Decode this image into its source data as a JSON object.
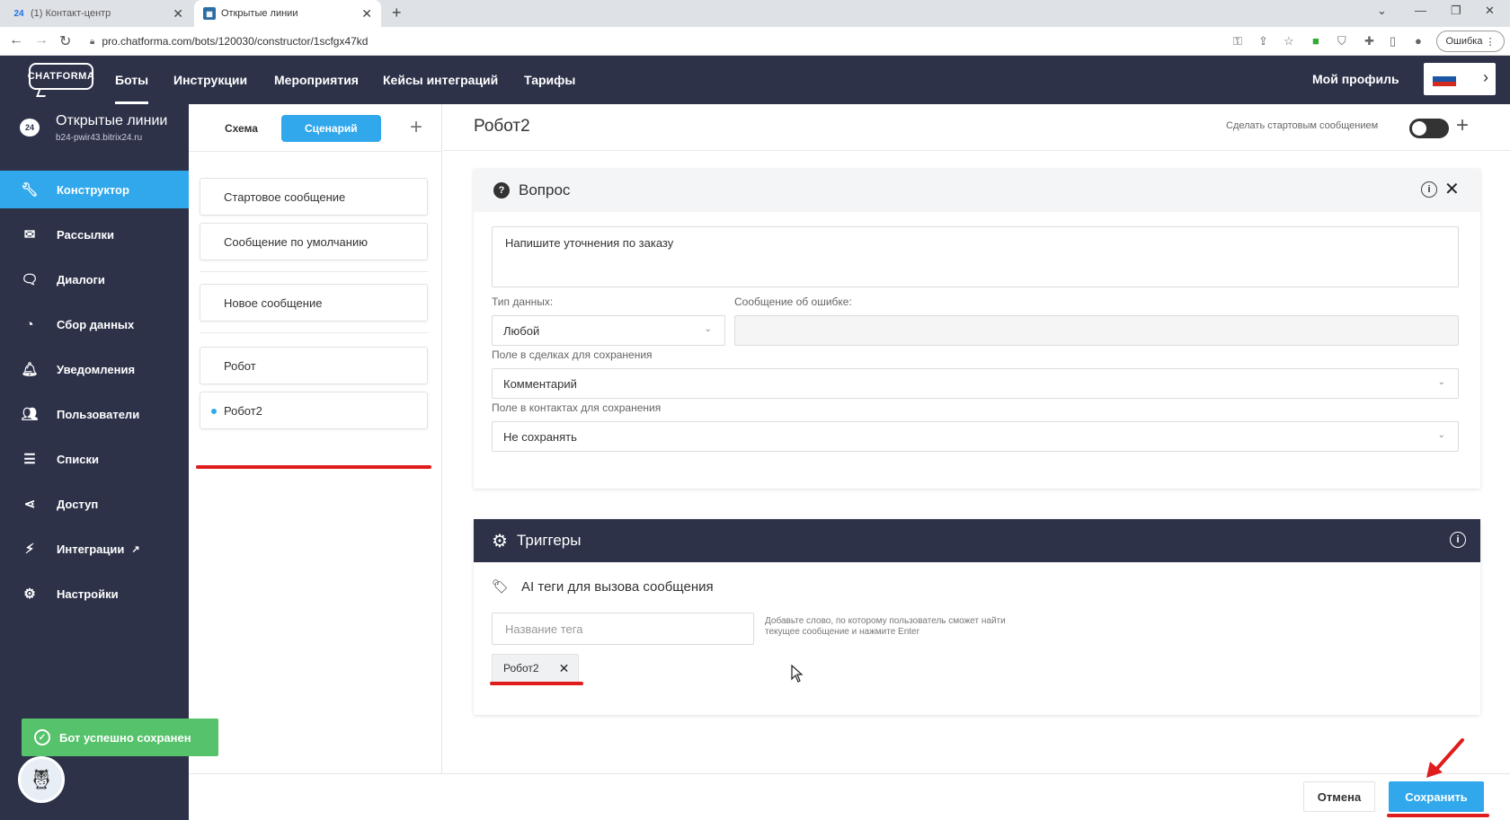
{
  "browser": {
    "tabs": [
      {
        "icon": "24",
        "title": "(1) Контакт-центр"
      },
      {
        "icon": "",
        "title": "Открытые линии"
      }
    ],
    "url": "pro.chatforma.com/bots/120030/constructor/1scfgx47kd",
    "profile_button": "Ошибка"
  },
  "header": {
    "logo": "CHATFORMA",
    "nav": [
      "Боты",
      "Инструкции",
      "Мероприятия",
      "Кейсы интеграций",
      "Тарифы"
    ],
    "active_nav": "Боты",
    "profile": "Мой профиль",
    "flag_colors": [
      "#ffffff",
      "#1c57a5",
      "#d52b1e"
    ]
  },
  "sidebar": {
    "project_icon": "24",
    "project_name": "Открытые линии",
    "project_sub": "b24-pwir43.bitrix24.ru",
    "items": [
      {
        "label": "Конструктор",
        "icon": "wrench-icon",
        "active": true
      },
      {
        "label": "Рассылки",
        "icon": "envelope-icon"
      },
      {
        "label": "Диалоги",
        "icon": "chat-icon"
      },
      {
        "label": "Сбор данных",
        "icon": "refresh-icon"
      },
      {
        "label": "Уведомления",
        "icon": "bell-icon"
      },
      {
        "label": "Пользователи",
        "icon": "users-icon"
      },
      {
        "label": "Списки",
        "icon": "list-icon"
      },
      {
        "label": "Доступ",
        "icon": "share-icon"
      },
      {
        "label": "Интеграции",
        "icon": "plug-icon"
      },
      {
        "label": "Настройки",
        "icon": "gear-icon"
      }
    ],
    "toast": "Бот успешно сохранен"
  },
  "middle": {
    "tabs": [
      "Схема",
      "Сценарий"
    ],
    "active_tab": "Сценарий",
    "messages": {
      "start": "Стартовое сообщение",
      "default": "Сообщение по умолчанию",
      "new": "Новое сообщение",
      "robot": "Робот",
      "robot2": "Робот2"
    }
  },
  "editor": {
    "title": "Робот2",
    "start_toggle_label": "Сделать стартовым сообщением",
    "start_toggle_on": false,
    "question": {
      "title": "Вопрос",
      "text": "Напишите уточнения по заказу",
      "data_type_label": "Тип данных:",
      "data_type_value": "Любой",
      "error_label": "Сообщение об ошибке:",
      "error_value": "",
      "deal_field_label": "Поле в сделках для сохранения",
      "deal_field_value": "Комментарий",
      "contact_field_label": "Поле в контактах для сохранения",
      "contact_field_value": "Не сохранять"
    },
    "triggers": {
      "title": "Триггеры",
      "tags_title": "AI теги для вызова сообщения",
      "tag_placeholder": "Название тега",
      "tag_hint": "Добавьте слово, по которому пользователь сможет найти текущее сообщение и нажмите Enter",
      "tags": [
        "Робот2"
      ]
    }
  },
  "footer": {
    "cancel": "Отмена",
    "save": "Сохранить"
  },
  "colors": {
    "dark": "#2d3249",
    "accent": "#31a8ec",
    "success": "#56c26c",
    "annotation": "#e01c1c"
  }
}
